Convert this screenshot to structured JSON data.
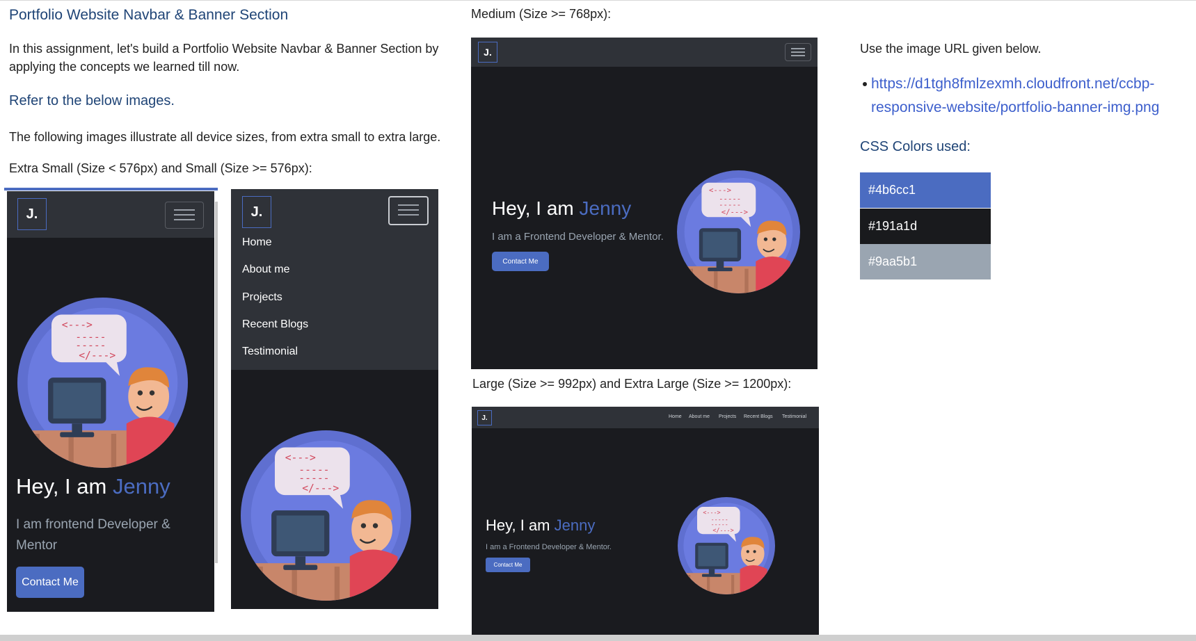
{
  "left": {
    "title": "Portfolio Website Navbar & Banner Section",
    "intro": "In this assignment, let's build a Portfolio Website Navbar & Banner Section by applying the concepts we learned till now.",
    "refer_heading": "Refer to the below images.",
    "sizes_text": "The following images illustrate all device sizes, from extra small to extra large.",
    "xs_caption": "Extra Small (Size < 576px) and Small (Size >= 576px):"
  },
  "middle": {
    "md_caption": "Medium (Size >= 768px):",
    "lg_caption": "Large (Size >= 992px) and Extra Large (Size >= 1200px):"
  },
  "right": {
    "use_url_text": "Use the image URL given below.",
    "url": "https://d1tgh8fmlzexmh.cloudfront.net/ccbp-responsive-website/portfolio-banner-img.png",
    "url_line1": "https://d1tgh8fmlzexmh.cloudfront.net/ccbp-",
    "url_line2": "responsive-website/portfolio-banner-img.png",
    "colors_heading": "CSS Colors used:",
    "colors": [
      {
        "hex": "#4b6cc1",
        "label": "#4b6cc1"
      },
      {
        "hex": "#191a1d",
        "label": "#191a1d"
      },
      {
        "hex": "#9aa5b1",
        "label": "#9aa5b1"
      }
    ]
  },
  "mockup": {
    "logo": "J.",
    "hey": "Hey, I am ",
    "name": "Jenny",
    "desc_xs": "I am frontend Developer & Mentor",
    "desc": "I am a Frontend Developer & Mentor.",
    "button": "Contact Me",
    "menu": [
      "Home",
      "About me",
      "Projects",
      "Recent Blogs",
      "Testimonial"
    ]
  }
}
